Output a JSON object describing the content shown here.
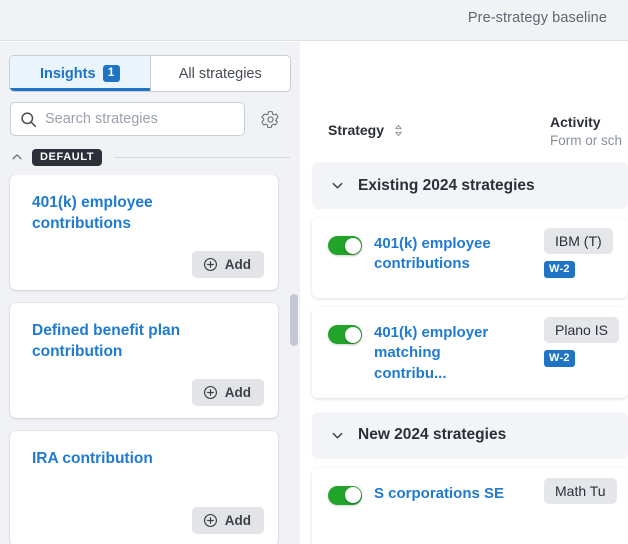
{
  "topbar": {
    "title": "Pre-strategy baseline"
  },
  "sidebar": {
    "tabs": [
      {
        "label": "Insights",
        "badge": "1",
        "active": true
      },
      {
        "label": "All strategies",
        "badge": "",
        "active": false
      }
    ],
    "search": {
      "placeholder": "Search strategies",
      "value": ""
    },
    "settings_icon": "gear-icon",
    "group": {
      "label": "DEFAULT",
      "collapse_icon": "chevron-up-icon"
    },
    "cards": [
      {
        "title": "401(k) employee contributions",
        "action": "Add"
      },
      {
        "title": "Defined benefit plan contribution",
        "action": "Add"
      },
      {
        "title": "IRA contribution",
        "action": "Add"
      }
    ]
  },
  "main": {
    "columns": {
      "strategy": "Strategy",
      "strategy_sort_icon": "sort-updown-icon",
      "activity": "Activity",
      "activity_sub": "Form or sch"
    },
    "sections": [
      {
        "title": "Existing 2024 strategies",
        "collapse_icon": "chevron-down-icon",
        "rows": [
          {
            "name": "401(k) employee contributions",
            "enabled": true,
            "activity": "IBM (T)",
            "tag": "W-2"
          },
          {
            "name": "401(k) employer matching contribu...",
            "enabled": true,
            "activity": "Plano IS",
            "tag": "W-2"
          }
        ]
      },
      {
        "title": "New 2024 strategies",
        "collapse_icon": "chevron-down-icon",
        "rows": [
          {
            "name": "S corporations SE",
            "enabled": true,
            "activity": "Math Tu",
            "tag": ""
          }
        ]
      }
    ]
  },
  "colors": {
    "accent_blue": "#1f74c4",
    "link_blue": "#1f7ad0",
    "toggle_green": "#22a32a",
    "chip_dark": "#2b3038",
    "panel_bg": "#f1f2f5"
  }
}
